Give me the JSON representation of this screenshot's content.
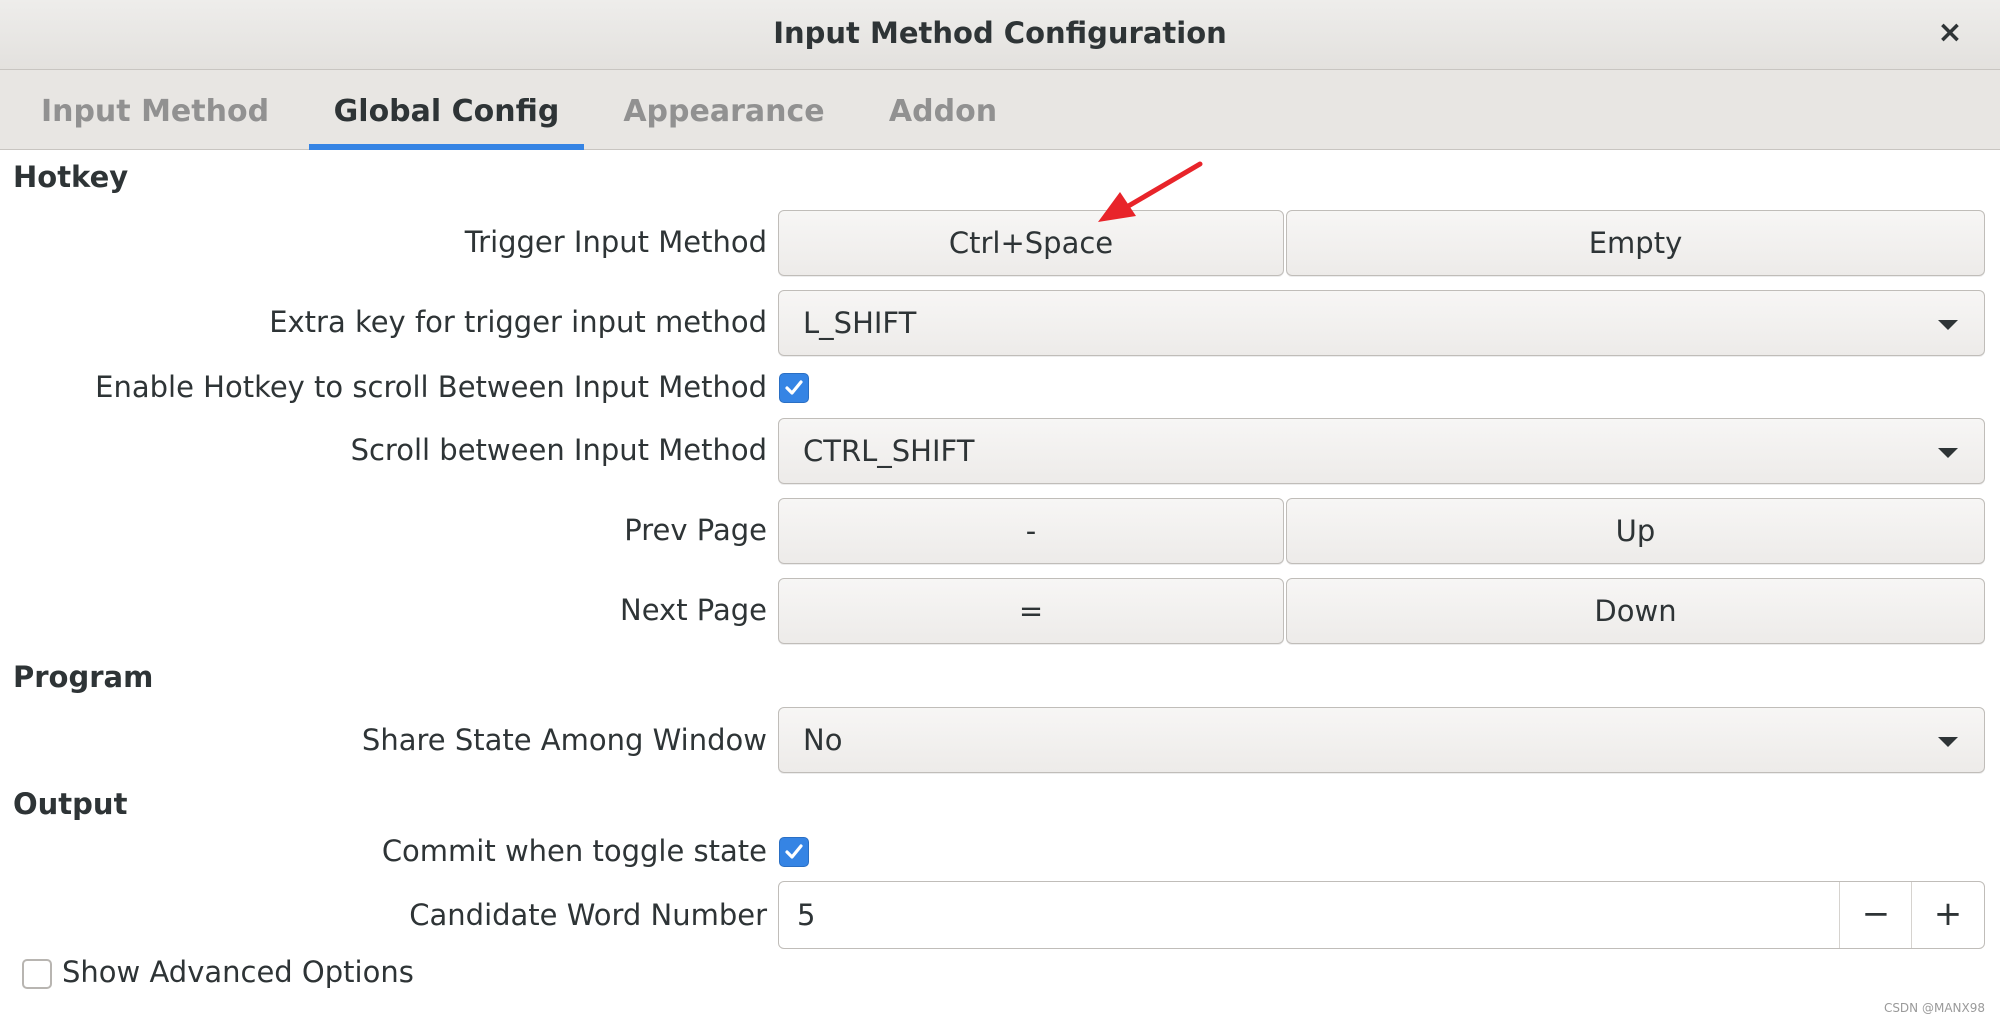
{
  "window": {
    "title": "Input Method Configuration",
    "close_glyph": "×"
  },
  "tabs": [
    {
      "label": "Input Method"
    },
    {
      "label": "Global Config"
    },
    {
      "label": "Appearance"
    },
    {
      "label": "Addon"
    }
  ],
  "active_tab": "Global Config",
  "hotkey": {
    "heading": "Hotkey",
    "trigger": {
      "label": "Trigger Input Method",
      "key1": "Ctrl+Space",
      "key2": "Empty"
    },
    "extra_key": {
      "label": "Extra key for trigger input method",
      "value": "L_SHIFT"
    },
    "enable_scroll": {
      "label": "Enable Hotkey to scroll Between Input Method",
      "checked": true
    },
    "scroll_between": {
      "label": "Scroll between Input Method",
      "value": "CTRL_SHIFT"
    },
    "prev_page": {
      "label": "Prev Page",
      "key1": "-",
      "key2": "Up"
    },
    "next_page": {
      "label": "Next Page",
      "key1": "=",
      "key2": "Down"
    }
  },
  "program": {
    "heading": "Program",
    "share_state": {
      "label": "Share State Among Window",
      "value": "No"
    }
  },
  "output": {
    "heading": "Output",
    "commit_toggle": {
      "label": "Commit when toggle state",
      "checked": true
    },
    "candidate_number": {
      "label": "Candidate Word Number",
      "value": "5",
      "minus": "−",
      "plus": "+"
    }
  },
  "advanced": {
    "label": "Show Advanced Options",
    "checked": false
  },
  "watermark": "CSDN @MANX98",
  "colors": {
    "accent": "#3584e4",
    "annotation_arrow": "#e8242a"
  }
}
